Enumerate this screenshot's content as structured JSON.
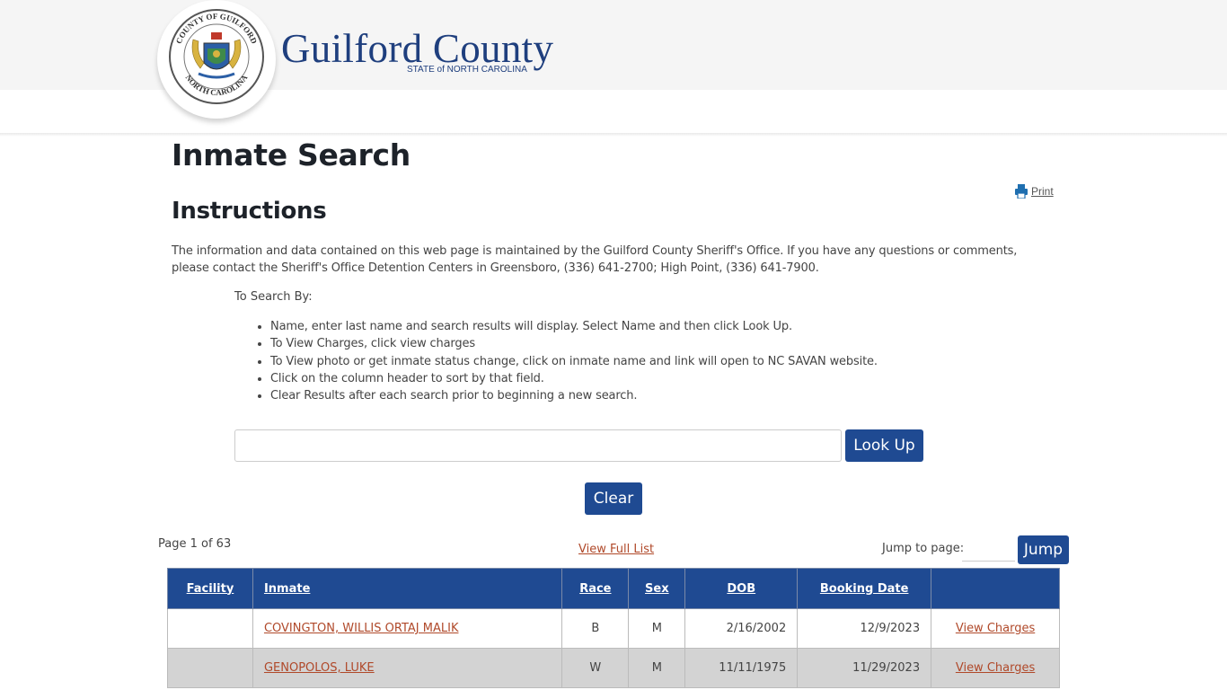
{
  "header": {
    "county_name": "Guilford County",
    "state_line": "STATE of NORTH CAROLINA",
    "seal_text_top": "COUNTY OF GUILFORD",
    "seal_text_bottom": "NORTH CAROLINA"
  },
  "page": {
    "title": "Inmate Search",
    "section_title": "Instructions",
    "print_label": "Print",
    "intro": "The information and data contained on this web page is maintained by the Guilford County Sheriff's Office. If you have any questions or comments, please contact the Sheriff's Office Detention Centers in Greensboro, (336) 641-2700; High Point, (336) 641-7900.",
    "search_by": "To Search By:",
    "tips": [
      "Name, enter last name and search results will display. Select Name and then click Look Up.",
      "To View Charges, click view charges",
      "To View photo or get inmate status change, click on inmate name and link will open to NC SAVAN website.",
      "Click on the column header to sort by that field.",
      "Clear Results after each search prior to beginning a new search."
    ]
  },
  "search": {
    "value": "",
    "placeholder": "",
    "lookup_label": "Look Up",
    "clear_label": "Clear"
  },
  "pager": {
    "page_info": "Page 1 of 63",
    "full_list_label": "View Full List",
    "jump_label": "Jump to page:",
    "jump_value": "",
    "jump_button": "Jump"
  },
  "table": {
    "headers": [
      "Facility",
      "Inmate",
      "Race",
      "Sex",
      "DOB",
      "Booking Date",
      ""
    ],
    "rows": [
      {
        "facility": "",
        "inmate": "COVINGTON, WILLIS ORTAJ MALIK",
        "race": "B",
        "sex": "M",
        "dob": "2/16/2002",
        "booking": "12/9/2023",
        "action": "View Charges"
      },
      {
        "facility": "",
        "inmate": "GENOPOLOS, LUKE",
        "race": "W",
        "sex": "M",
        "dob": "11/11/1975",
        "booking": "11/29/2023",
        "action": "View Charges"
      }
    ]
  },
  "colors": {
    "primary": "#1f4a92",
    "link": "#b0492a",
    "logo": "#1f3f7e",
    "alt_row": "#d3d3d3"
  }
}
